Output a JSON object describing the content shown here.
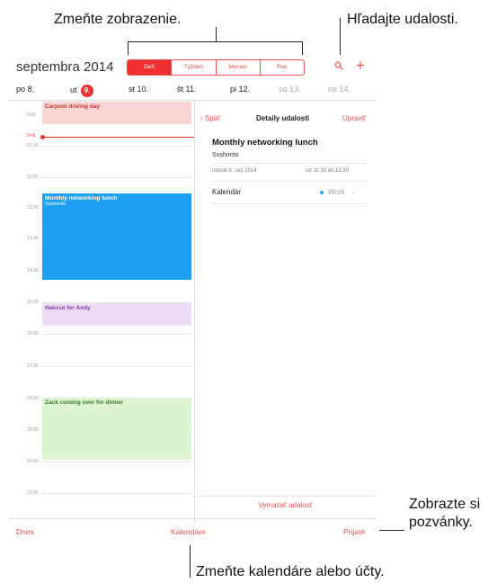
{
  "callouts": {
    "view": "Zmeňte zobrazenie.",
    "search": "Hľadajte udalosti.",
    "invites": "Zobrazte si\npozvánky.",
    "calendars": "Zmeňte kalendáre alebo účty."
  },
  "header": {
    "month": "septembra 2014",
    "segments": [
      {
        "label": "Deň",
        "active": true
      },
      {
        "label": "Týždeň",
        "active": false
      },
      {
        "label": "Mesiac",
        "active": false
      },
      {
        "label": "Rok",
        "active": false
      }
    ],
    "search_icon": "search-icon",
    "add_icon": "plus-icon"
  },
  "days": [
    {
      "name": "po",
      "num": "8."
    },
    {
      "name": "ut",
      "num": "9."
    },
    {
      "name": "st",
      "num": "10."
    },
    {
      "name": "št",
      "num": "11."
    },
    {
      "name": "pi",
      "num": "12."
    },
    {
      "name": "so",
      "num": "13."
    },
    {
      "name": "ne",
      "num": "14."
    }
  ],
  "timeline": {
    "now": "9:41",
    "hours": [
      "9:00",
      "10:00",
      "11:00",
      "12:00",
      "13:00",
      "14:00",
      "15:00",
      "16:00",
      "17:00",
      "18:00",
      "19:00",
      "20:00",
      "21:00"
    ]
  },
  "events": [
    {
      "title": "Carpool driving day",
      "subtitle": "",
      "color": "#fbd5d5",
      "text": "#c0392b"
    },
    {
      "title": "Monthly networking lunch",
      "subtitle": "Sushirrito",
      "color": "#1ea0f0",
      "text": "#ffffff"
    },
    {
      "title": "Haircut for Andy",
      "subtitle": "",
      "color": "#eedcf7",
      "text": "#7a3aa0"
    },
    {
      "title": "Zack coming over for dinner",
      "subtitle": "",
      "color": "#dcf4d2",
      "text": "#3b7d2a"
    }
  ],
  "detail": {
    "back": "Späť",
    "title": "Detaily udalosti",
    "edit": "Upraviť",
    "event_title": "Monthly networking lunch",
    "location": "Sushirrito",
    "date": "utorok,9. sep 2014",
    "time": "od 11:30 do 13:30",
    "calendar_label": "Kalendár",
    "calendar_value": "Work",
    "delete": "Vymazať udalosť"
  },
  "toolbar": {
    "today": "Dnes",
    "calendars": "Kalendáre",
    "inbox": "Prijaté"
  }
}
